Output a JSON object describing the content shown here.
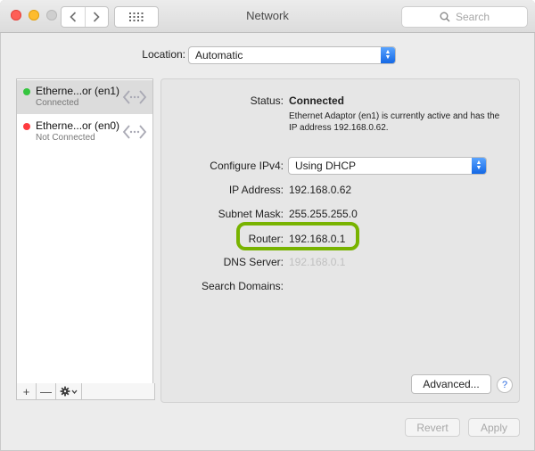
{
  "window": {
    "title": "Network",
    "search_placeholder": "Search"
  },
  "location": {
    "label": "Location:",
    "value": "Automatic"
  },
  "services": [
    {
      "name": "Etherne...or (en1)",
      "state": "Connected",
      "status_color": "#35c53f",
      "selected": true
    },
    {
      "name": "Etherne...or (en0)",
      "state": "Not Connected",
      "status_color": "#ff3b3f",
      "selected": false
    }
  ],
  "details": {
    "status_label": "Status:",
    "status_value": "Connected",
    "status_description": "Ethernet Adaptor (en1) is currently active and has the IP address 192.168.0.62.",
    "configure_label": "Configure IPv4:",
    "configure_value": "Using DHCP",
    "ip_label": "IP Address:",
    "ip_value": "192.168.0.62",
    "subnet_label": "Subnet Mask:",
    "subnet_value": "255.255.255.0",
    "router_label": "Router:",
    "router_value": "192.168.0.1",
    "dns_label": "DNS Server:",
    "dns_value": "192.168.0.1",
    "search_domains_label": "Search Domains:"
  },
  "buttons": {
    "advanced": "Advanced...",
    "help": "?",
    "revert": "Revert",
    "apply": "Apply",
    "add": "+",
    "remove": "—"
  },
  "colors": {
    "highlight": "#78b300",
    "accent": "#1468e5"
  }
}
